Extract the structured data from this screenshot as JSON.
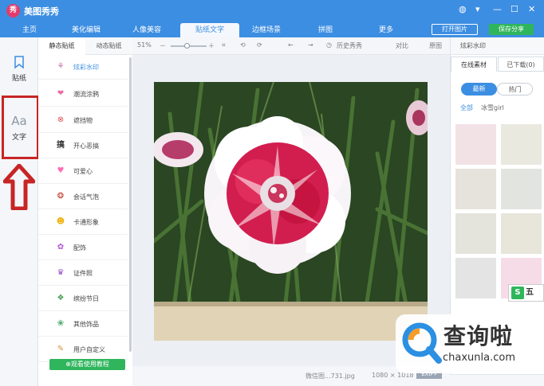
{
  "app": {
    "title": "美图秀秀",
    "logo_char": "秀"
  },
  "window_controls": {
    "chat": "◍",
    "menu": "▾",
    "min": "—",
    "max": "☐",
    "close": "✕"
  },
  "tabs": [
    {
      "label": "主页"
    },
    {
      "label": "美化编辑"
    },
    {
      "label": "人像美容"
    },
    {
      "label": "贴纸文字"
    },
    {
      "label": "边框场景"
    },
    {
      "label": "拼图"
    },
    {
      "label": "更多"
    }
  ],
  "header_buttons": {
    "open_image": "打开图片",
    "save_share": "保存分享"
  },
  "leftbar": {
    "sticker_label": "贴纸",
    "text_label": "文字",
    "text_icon": "Aa"
  },
  "subtabs": {
    "static": "静态贴纸",
    "dynamic": "动态贴纸"
  },
  "categories": [
    {
      "label": "炫彩水印",
      "icon": "⚘",
      "color": "#c76fb2"
    },
    {
      "label": "潮流涂鸦",
      "icon": "❤",
      "color": "#f06aa8"
    },
    {
      "label": "遮挡物",
      "icon": "⊗",
      "color": "#e05050"
    },
    {
      "label": "开心恶搞",
      "icon": "搞",
      "color": "#333333"
    },
    {
      "label": "可爱心",
      "icon": "♥",
      "color": "#ff6fb5"
    },
    {
      "label": "会话气泡",
      "icon": "❂",
      "color": "#c0392b"
    },
    {
      "label": "卡通形象",
      "icon": "☻",
      "color": "#f1b20f"
    },
    {
      "label": "配饰",
      "icon": "✿",
      "color": "#b253d0"
    },
    {
      "label": "证件照",
      "icon": "♛",
      "color": "#a050c8"
    },
    {
      "label": "缤纷节日",
      "icon": "❖",
      "color": "#3c9e4f"
    },
    {
      "label": "其他饰品",
      "icon": "❀",
      "color": "#4aa86a"
    },
    {
      "label": "用户自定义",
      "icon": "✎",
      "color": "#d9913a"
    }
  ],
  "tutorial_button": "⊕观看使用教程",
  "toolbar": {
    "zoom": "51%",
    "undo_history": "历史秀秀",
    "compare": "对比",
    "original": "原图"
  },
  "statusbar": {
    "filename": "微信图...731.jpg",
    "dimensions": "1080 × 1018",
    "exif": "EXIF»"
  },
  "rightpanel": {
    "header": "炫彩水印",
    "tab_online": "在线素材",
    "tab_downloaded": "已下载(0)",
    "pill_newest": "最新",
    "pill_hot": "热门",
    "filter_all": "全部",
    "filter_ice": "冰雪girl"
  },
  "overlay": {
    "badge": "五",
    "watermark_title": "查询啦",
    "watermark_url": "chaxunla.com"
  },
  "colors": {
    "brand": "#3c8ee2",
    "save_green": "#2fb55c",
    "highlight_red": "#c72525"
  }
}
